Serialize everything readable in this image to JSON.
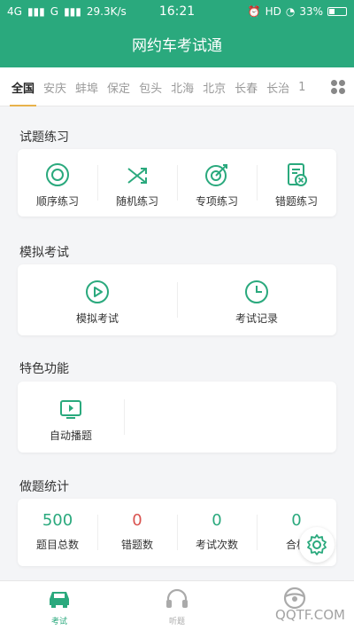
{
  "status_bar": {
    "network1": "4G",
    "network2": "G",
    "speed": "29.3K/s",
    "time": "16:21",
    "hd": "HD",
    "battery": "33%",
    "battery_level": 0.33
  },
  "app": {
    "title": "网约车考试通"
  },
  "cities": [
    "全国",
    "安庆",
    "蚌埠",
    "保定",
    "包头",
    "北海",
    "北京",
    "长春",
    "长治",
    "1"
  ],
  "active_city": "全国",
  "practice": {
    "title": "试题练习",
    "items": [
      {
        "label": "顺序练习",
        "icon": "sequence-icon"
      },
      {
        "label": "随机练习",
        "icon": "shuffle-icon"
      },
      {
        "label": "专项练习",
        "icon": "target-icon"
      },
      {
        "label": "错题练习",
        "icon": "wrong-doc-icon"
      }
    ]
  },
  "mock": {
    "title": "模拟考试",
    "items": [
      {
        "label": "模拟考试",
        "icon": "play-icon"
      },
      {
        "label": "考试记录",
        "icon": "clock-icon"
      }
    ]
  },
  "features": {
    "title": "特色功能",
    "items": [
      {
        "label": "自动播题",
        "icon": "video-play-icon"
      }
    ]
  },
  "stats": {
    "title": "做题统计",
    "items": [
      {
        "value": "500",
        "label": "题目总数",
        "color": "#2aa97d"
      },
      {
        "value": "0",
        "label": "错题数",
        "color": "#d9534f"
      },
      {
        "value": "0",
        "label": "考试次数",
        "color": "#2aa97d"
      },
      {
        "value": "0",
        "label": "合格",
        "color": "#2aa97d"
      }
    ]
  },
  "tabs": [
    {
      "label": "考试",
      "icon": "car-icon",
      "active": true
    },
    {
      "label": "听题",
      "icon": "headphones-icon",
      "active": false
    },
    {
      "label": "",
      "icon": "steering-wheel-icon",
      "active": false
    }
  ],
  "watermark": "QQTF.COM",
  "colors": {
    "primary": "#2aa97d",
    "accent": "#e8b24b",
    "danger": "#d9534f"
  }
}
